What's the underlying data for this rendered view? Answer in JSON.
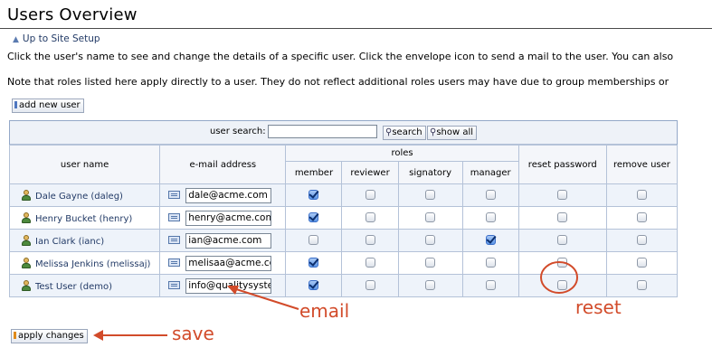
{
  "page": {
    "title": "Users Overview",
    "breadcrumb": "Up to Site Setup",
    "description_1": "Click the user's name to see and change the details of a specific user. Click the envelope icon to send a mail to the user. You can also",
    "description_2": "Note that roles listed here apply directly to a user. They do not reflect additional roles users may have due to group memberships or",
    "add_user_label": "add new user",
    "apply_label": "apply changes"
  },
  "search": {
    "label": "user search:",
    "value": "",
    "search_button": "search",
    "show_all_button": "show all"
  },
  "table": {
    "headers": {
      "user_name": "user name",
      "email": "e-mail address",
      "roles": "roles",
      "reset_password": "reset password",
      "remove_user": "remove user"
    },
    "role_headers": [
      "member",
      "reviewer",
      "signatory",
      "manager"
    ],
    "rows": [
      {
        "name": "Dale Gayne (daleg)",
        "email": "dale@acme.com",
        "roles": [
          true,
          false,
          false,
          false
        ],
        "reset": false,
        "remove": false
      },
      {
        "name": "Henry Bucket (henry)",
        "email": "henry@acme.com",
        "roles": [
          true,
          false,
          false,
          false
        ],
        "reset": false,
        "remove": false
      },
      {
        "name": "Ian Clark (ianc)",
        "email": "ian@acme.com",
        "roles": [
          false,
          false,
          false,
          true
        ],
        "reset": false,
        "remove": false
      },
      {
        "name": "Melissa Jenkins (melissaj)",
        "email": "melisaa@acme.cc",
        "roles": [
          true,
          false,
          false,
          false
        ],
        "reset": false,
        "remove": false
      },
      {
        "name": "Test User (demo)",
        "email": "info@qualitysyste",
        "roles": [
          true,
          false,
          false,
          false
        ],
        "reset": false,
        "remove": false
      }
    ]
  },
  "annotations": {
    "email": "email",
    "reset": "reset",
    "save": "save",
    "color": "#d24b2a"
  }
}
